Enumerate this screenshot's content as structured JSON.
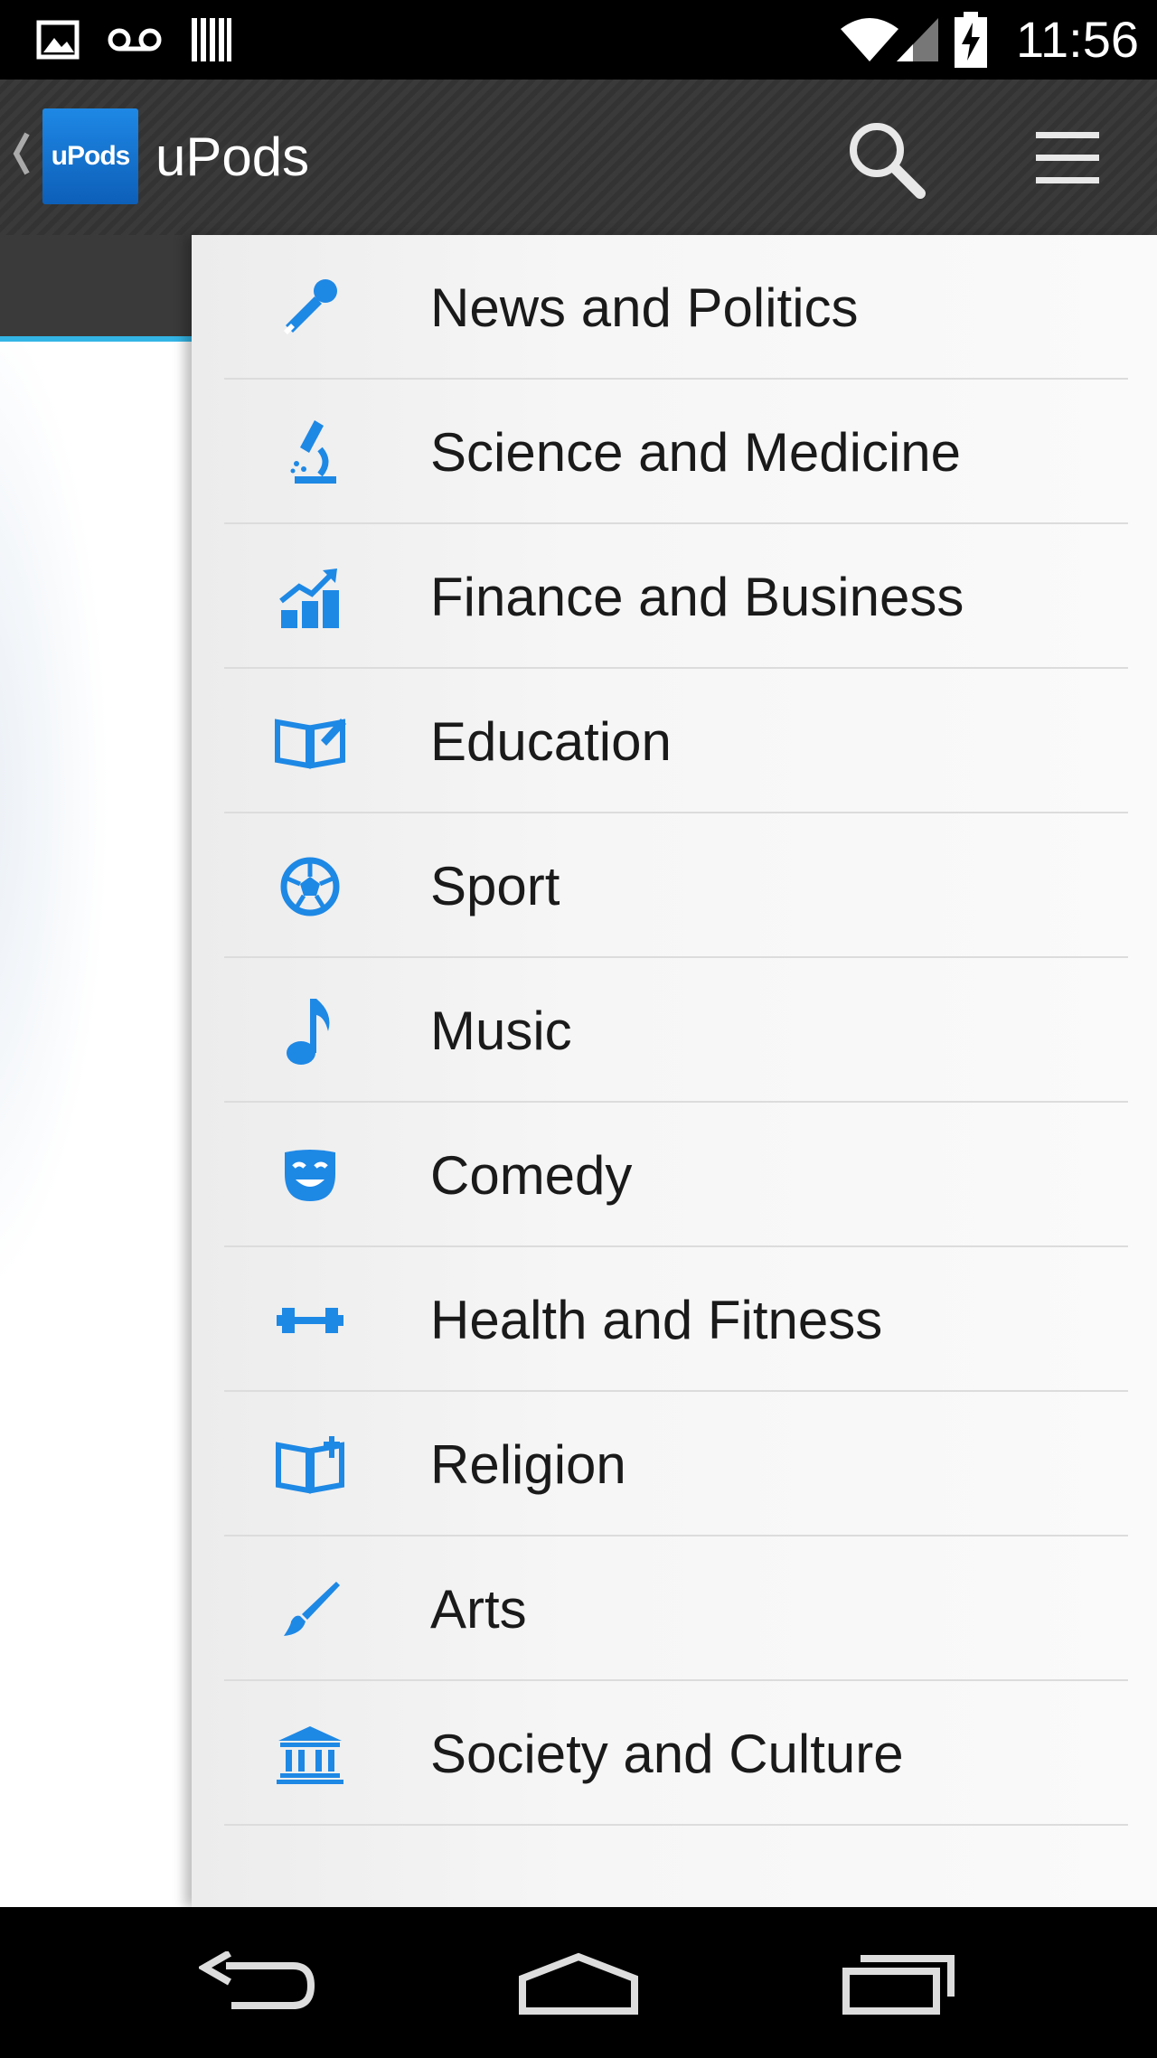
{
  "status_bar": {
    "time": "11:56",
    "icons": [
      "image-notification-icon",
      "voicemail-icon",
      "barcode-notification-icon",
      "wifi-icon",
      "cell-signal-icon",
      "battery-charging-icon"
    ]
  },
  "action_bar": {
    "title": "uPods",
    "logo_text": "uPods",
    "icons": [
      "up-chevron-icon",
      "search-icon",
      "overflow-menu-icon"
    ]
  },
  "categories": [
    {
      "label": "News and Politics",
      "icon": "microphone-icon"
    },
    {
      "label": "Science and Medicine",
      "icon": "microscope-icon"
    },
    {
      "label": "Finance and Business",
      "icon": "chart-growth-icon"
    },
    {
      "label": "Education",
      "icon": "open-book-pen-icon"
    },
    {
      "label": "Sport",
      "icon": "soccer-ball-icon"
    },
    {
      "label": "Music",
      "icon": "music-note-icon"
    },
    {
      "label": "Comedy",
      "icon": "comedy-mask-icon"
    },
    {
      "label": "Health and Fitness",
      "icon": "dumbbell-icon"
    },
    {
      "label": "Religion",
      "icon": "scripture-book-icon"
    },
    {
      "label": "Arts",
      "icon": "paintbrush-icon"
    },
    {
      "label": "Society and Culture",
      "icon": "institution-icon"
    }
  ],
  "colors": {
    "accent": "#1e88e5",
    "tab_indicator": "#33b5e5",
    "action_bar": "#363636",
    "drawer_bg": "#f5f5f5",
    "text": "#1a1a1a"
  },
  "nav_bar": {
    "buttons": [
      "back-icon",
      "home-icon",
      "recents-icon"
    ]
  }
}
